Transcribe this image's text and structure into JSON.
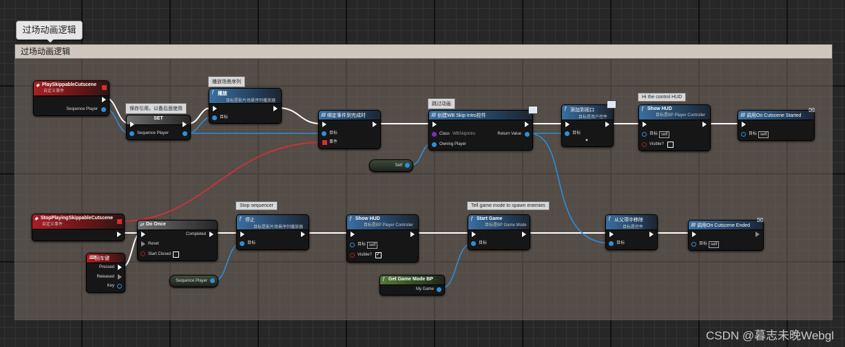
{
  "comment": {
    "bubble": "过场动画逻辑",
    "title": "过场动画逻辑"
  },
  "nodes": {
    "play_event": {
      "title": "PlaySkippableCutscene",
      "subtitle": "自定义事件",
      "pin": "Sequence Player"
    },
    "set": {
      "title": "SET",
      "pin": "Sequence Player",
      "tip": "保存引用，以备后面使用"
    },
    "play": {
      "title": "播放",
      "subtitle": "目标是影片场景序列播放器",
      "pin": "目标",
      "tip": "播放场景序列"
    },
    "bind": {
      "title": "绑定事件到完成时",
      "pin_target": "目标",
      "pin_event": "事件"
    },
    "create_widget": {
      "title": "创建WB Skip Intro控件",
      "class_label": "Class",
      "class_value": "WBSkipIntro",
      "owning": "Owning Player",
      "return": "Return Value",
      "tip": "跳过动画"
    },
    "self_var": {
      "label": "Self"
    },
    "add_viewport": {
      "title": "添加到视口",
      "subtitle": "目标是用户控件",
      "pin": "目标"
    },
    "show_hud_1": {
      "title": "Show HUD",
      "subtitle": "目标是BP Player Controller",
      "target": "目标",
      "self": "self",
      "visible": "Visible?",
      "tip": "Hi the control HUD"
    },
    "call_started": {
      "title": "调用On Cutscene Started",
      "target": "目标",
      "self": "self"
    },
    "stop_event": {
      "title": "StopPlayingSkippableCutscene",
      "subtitle": "自定义事件"
    },
    "do_once": {
      "title": "Do Once",
      "completed": "Completed",
      "reset": "Reset",
      "start_closed": "Start Closed"
    },
    "enter_key": {
      "title": "回车键",
      "pressed": "Pressed",
      "released": "Released",
      "key": "Key"
    },
    "stop": {
      "title": "停止",
      "subtitle": "目标是影片场景序列播放器",
      "pin": "目标",
      "tip": "Stop sequencer"
    },
    "seq_var": {
      "label": "Sequence Player"
    },
    "show_hud_2": {
      "title": "Show HUD",
      "subtitle": "目标是BP Player Controller",
      "target": "目标",
      "self": "self",
      "visible": "Visible?"
    },
    "get_game_mode": {
      "title": "Get Game Mode BP",
      "pin": "My Game"
    },
    "start_game": {
      "title": "Start Game",
      "subtitle": "目标是BP Game Mode",
      "pin": "目标",
      "tip": "Tell game mode to spawn enemies"
    },
    "remove_parent": {
      "title": "从父项中移除",
      "subtitle": "目标是控件",
      "pin": "目标"
    },
    "call_ended": {
      "title": "调用On Cutscene Ended",
      "target": "目标",
      "self": "self"
    }
  },
  "watermark": "CSDN @暮志未晚Webgl",
  "colors": {
    "exec_wire": "#ffffff",
    "object_wire": "#2e8fd9",
    "delegate_wire": "#c8323a",
    "event_header": "#a81e24",
    "function_header": "#3b6fa0"
  }
}
